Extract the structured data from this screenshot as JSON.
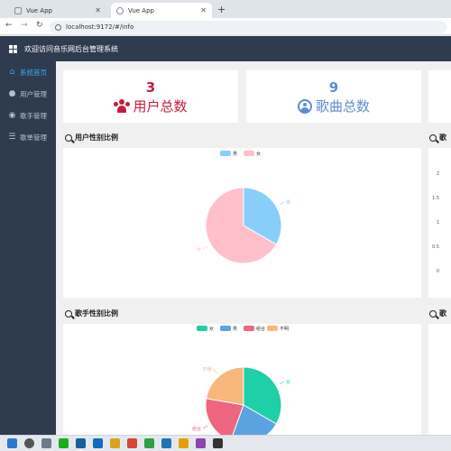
{
  "browser": {
    "tabs": [
      {
        "label": "Vue App",
        "active": false
      },
      {
        "label": "Vue App",
        "active": true
      }
    ],
    "url": "localhost:9172/#/info"
  },
  "app": {
    "title": "欢迎访问音乐网后台管理系统"
  },
  "sidebar": {
    "items": [
      {
        "label": "系统首页",
        "icon": "home-icon",
        "active": true
      },
      {
        "label": "用户管理",
        "icon": "user-icon",
        "active": false
      },
      {
        "label": "歌手管理",
        "icon": "singer-icon",
        "active": false
      },
      {
        "label": "歌单管理",
        "icon": "list-icon",
        "active": false
      }
    ]
  },
  "stats": {
    "users": {
      "value": "3",
      "label": "用户总数",
      "color": "#c51d3d"
    },
    "songs": {
      "value": "9",
      "label": "歌曲总数",
      "color": "#5b8dd6"
    }
  },
  "sections": {
    "user_gender_title": "用户性别比例",
    "song_title_partial": "歌",
    "singer_gender_title": "歌手性别比例",
    "partial4": "歌"
  },
  "chart_data": [
    {
      "type": "pie",
      "legend": [
        "男",
        "女"
      ],
      "values": [
        1,
        2
      ],
      "labels": [
        "男",
        "女"
      ],
      "colors": [
        "#87cefa",
        "#ffc0cb"
      ],
      "legend_position": "top"
    },
    {
      "type": "bar",
      "ylim": [
        0,
        2
      ],
      "yticks": [
        "2",
        "1.5",
        "1",
        "0.5",
        "0"
      ],
      "color": "#1ccba0"
    },
    {
      "type": "pie",
      "legend": [
        "女",
        "男",
        "组合",
        "不明"
      ],
      "values": [
        3,
        2,
        2,
        2
      ],
      "labels": [
        "女",
        "男",
        "组合",
        "不明"
      ],
      "colors": [
        "#1fcfa8",
        "#5ba2e0",
        "#ee6680",
        "#f8b77b"
      ],
      "legend_position": "top"
    }
  ]
}
